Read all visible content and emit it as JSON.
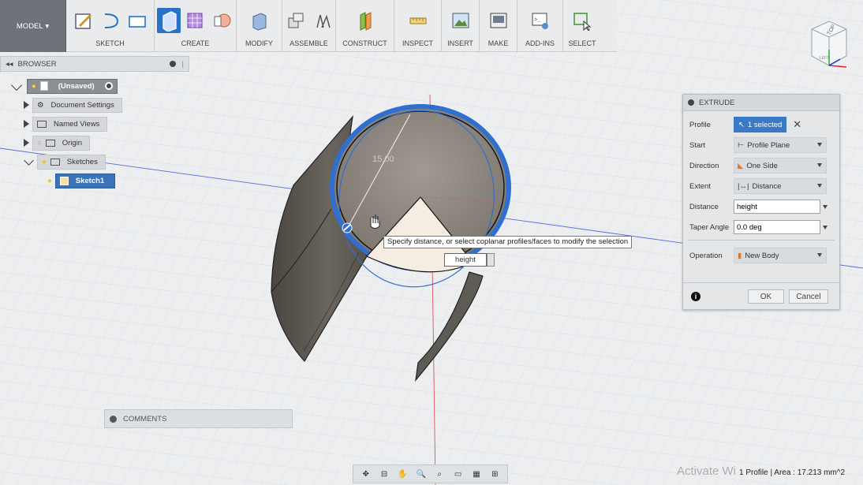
{
  "toolbar": {
    "model_label": "MODEL",
    "groups": [
      {
        "label": "SKETCH"
      },
      {
        "label": "CREATE"
      },
      {
        "label": "MODIFY"
      },
      {
        "label": "ASSEMBLE"
      },
      {
        "label": "CONSTRUCT"
      },
      {
        "label": "INSPECT"
      },
      {
        "label": "INSERT"
      },
      {
        "label": "MAKE"
      },
      {
        "label": "ADD-INS"
      },
      {
        "label": "SELECT"
      }
    ]
  },
  "browser": {
    "title": "BROWSER",
    "items": [
      {
        "label": "(Unsaved)"
      },
      {
        "label": "Document Settings"
      },
      {
        "label": "Named Views"
      },
      {
        "label": "Origin"
      },
      {
        "label": "Sketches"
      },
      {
        "label": "Sketch1"
      }
    ]
  },
  "canvas": {
    "dimension_label": "15.00",
    "tooltip": "Specify distance, or select coplanar profiles/faces to modify the selection",
    "height_input": "height"
  },
  "extrude": {
    "title": "EXTRUDE",
    "profile_label": "Profile",
    "profile_value": "1 selected",
    "start_label": "Start",
    "start_value": "Profile Plane",
    "direction_label": "Direction",
    "direction_value": "One Side",
    "extent_label": "Extent",
    "extent_value": "Distance",
    "distance_label": "Distance",
    "distance_value": "height",
    "taper_label": "Taper Angle",
    "taper_value": "0.0 deg",
    "operation_label": "Operation",
    "operation_value": "New Body",
    "ok_label": "OK",
    "cancel_label": "Cancel"
  },
  "comments": {
    "title": "COMMENTS"
  },
  "status": {
    "text": "1 Profile | Area : 17.213 mm^2",
    "watermark": "Activate Wi"
  },
  "viewcube": {
    "face_label": "TOP",
    "corner_label": "LEFT"
  },
  "colors": {
    "accent": "#2a72c8",
    "selected": "#3b73b8",
    "ring": "#2e6fd0",
    "body": "#5e5a54"
  },
  "icons": [
    "model-icon",
    "sketch-icon",
    "arc-icon",
    "rectangle-icon",
    "extrude-icon",
    "box-grid-icon",
    "revolve-icon",
    "press-pull-icon",
    "joint-icon",
    "assemble-icon",
    "plane-icon",
    "measure-icon",
    "insert-image-icon",
    "make-icon",
    "addins-icon",
    "select-icon"
  ]
}
